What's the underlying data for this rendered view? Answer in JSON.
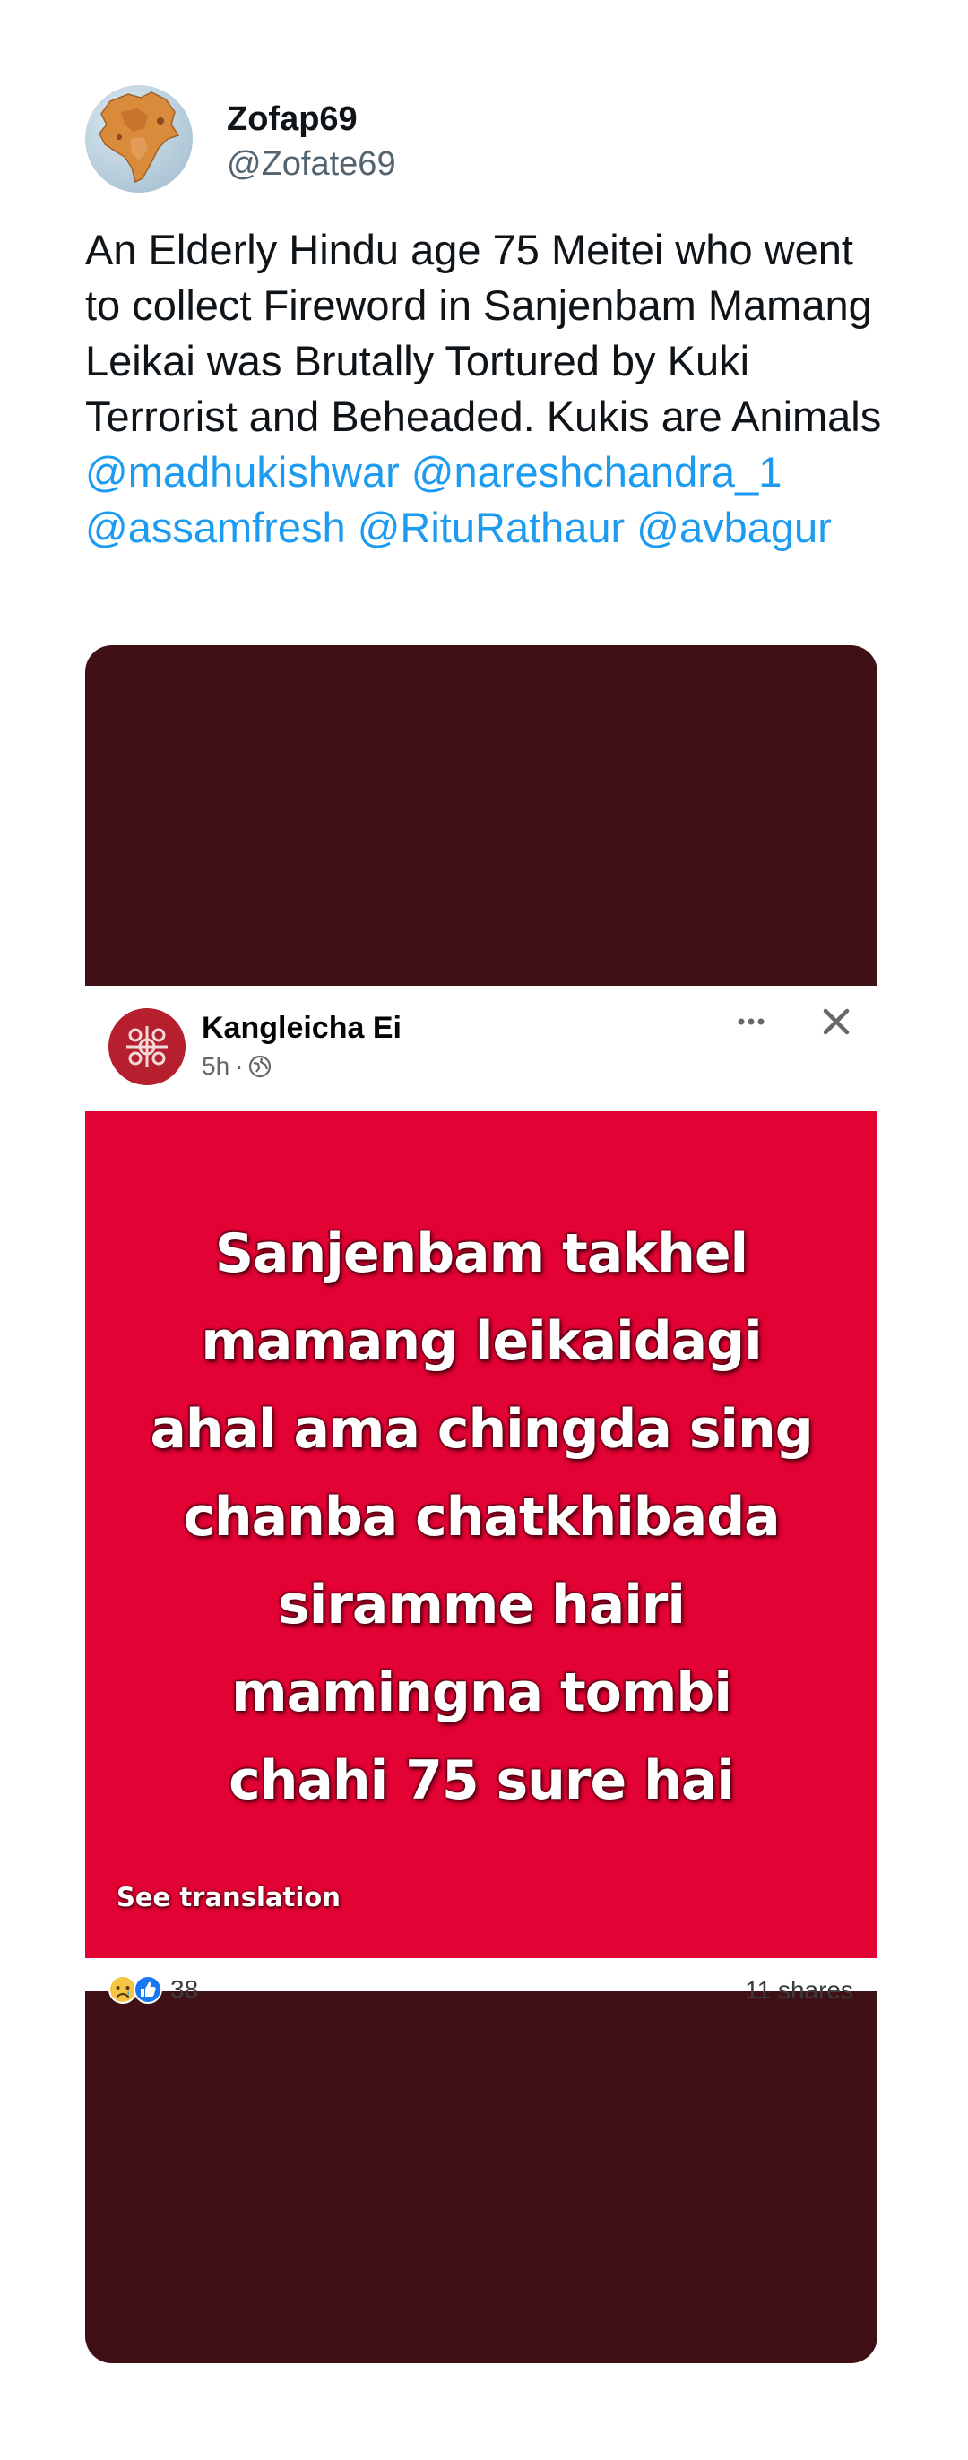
{
  "tweet": {
    "display_name": "Zofap69",
    "handle": "@Zofate69",
    "text_plain": "An Elderly Hindu age 75 Meitei who went to collect Fireword in Sanjenbam Mamang Leikai was Brutally Tortured by Kuki Terrorist and Beheaded. Kukis are Animals",
    "mentions": [
      "@madhukishwar",
      "@nareshchandra_1",
      "@assamfresh",
      "@RituRathaur",
      "@avbagur"
    ],
    "avatar_icon": "india-map-avatar"
  },
  "embedded_post": {
    "page_name": "Kangleicha Ei",
    "time": "5h",
    "meta_separator": "·",
    "privacy_icon": "globe-icon",
    "more_icon": "more-dots-icon",
    "close_icon": "close-icon",
    "image_text_lines": [
      "Sanjenbam takhel",
      "mamang leikaidagi",
      "ahal ama chingda sing",
      "chanba chatkhibada",
      "siramme hairi",
      "mamingna tombi",
      "chahi 75 sure hai"
    ],
    "see_translation": "See translation",
    "reaction_icons": [
      "sad-reaction-icon",
      "like-reaction-icon"
    ],
    "reaction_count": "38",
    "shares": "11 shares"
  },
  "colors": {
    "mention": "#1d9bf0",
    "media_background": "#3f1016",
    "card_red": "#e20234",
    "meta_gray": "#65676b"
  }
}
